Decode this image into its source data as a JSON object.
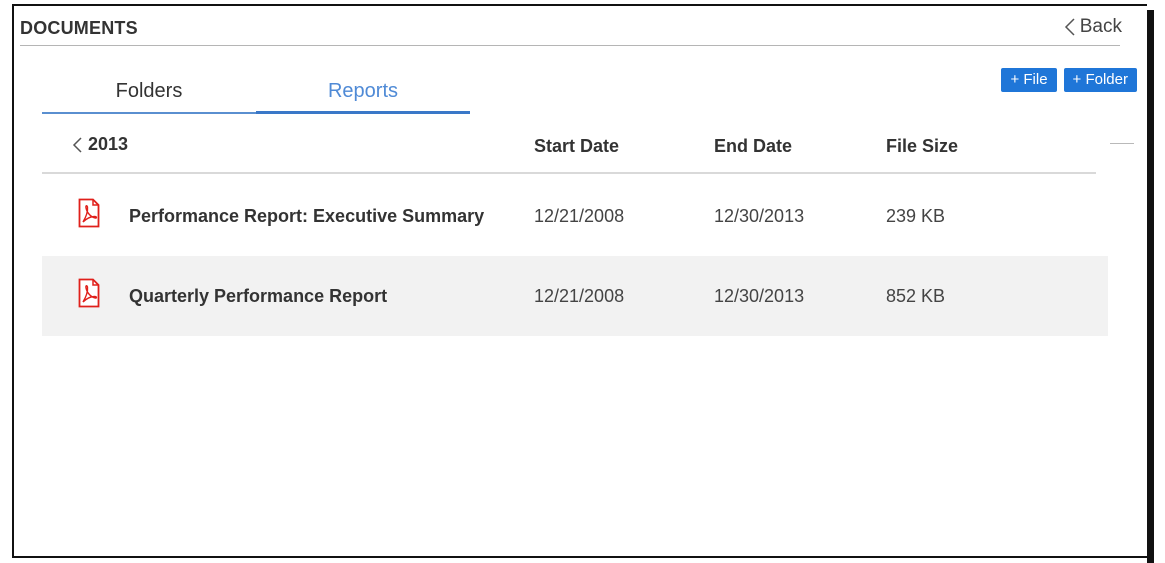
{
  "header": {
    "title": "DOCUMENTS",
    "back_label": "Back"
  },
  "tabs": [
    {
      "label": "Folders",
      "active": false
    },
    {
      "label": "Reports",
      "active": true
    }
  ],
  "actions": {
    "add_file_label": "+ File",
    "add_folder_label": "+ Folder"
  },
  "table": {
    "year": "2013",
    "columns": {
      "start_date": "Start Date",
      "end_date": "End Date",
      "file_size": "File Size"
    },
    "rows": [
      {
        "icon": "pdf-icon",
        "name": "Performance Report: Executive Summary",
        "start_date": "12/21/2008",
        "end_date": "12/30/2013",
        "file_size": "239 KB"
      },
      {
        "icon": "pdf-icon",
        "name": "Quarterly Performance Report",
        "start_date": "12/21/2008",
        "end_date": "12/30/2013",
        "file_size": "852 KB"
      }
    ]
  },
  "colors": {
    "accent": "#1f76d8",
    "tab_active_text": "#4f8ad6",
    "pdf_red": "#e0201b",
    "row_highlight": "#f2f2f2"
  }
}
